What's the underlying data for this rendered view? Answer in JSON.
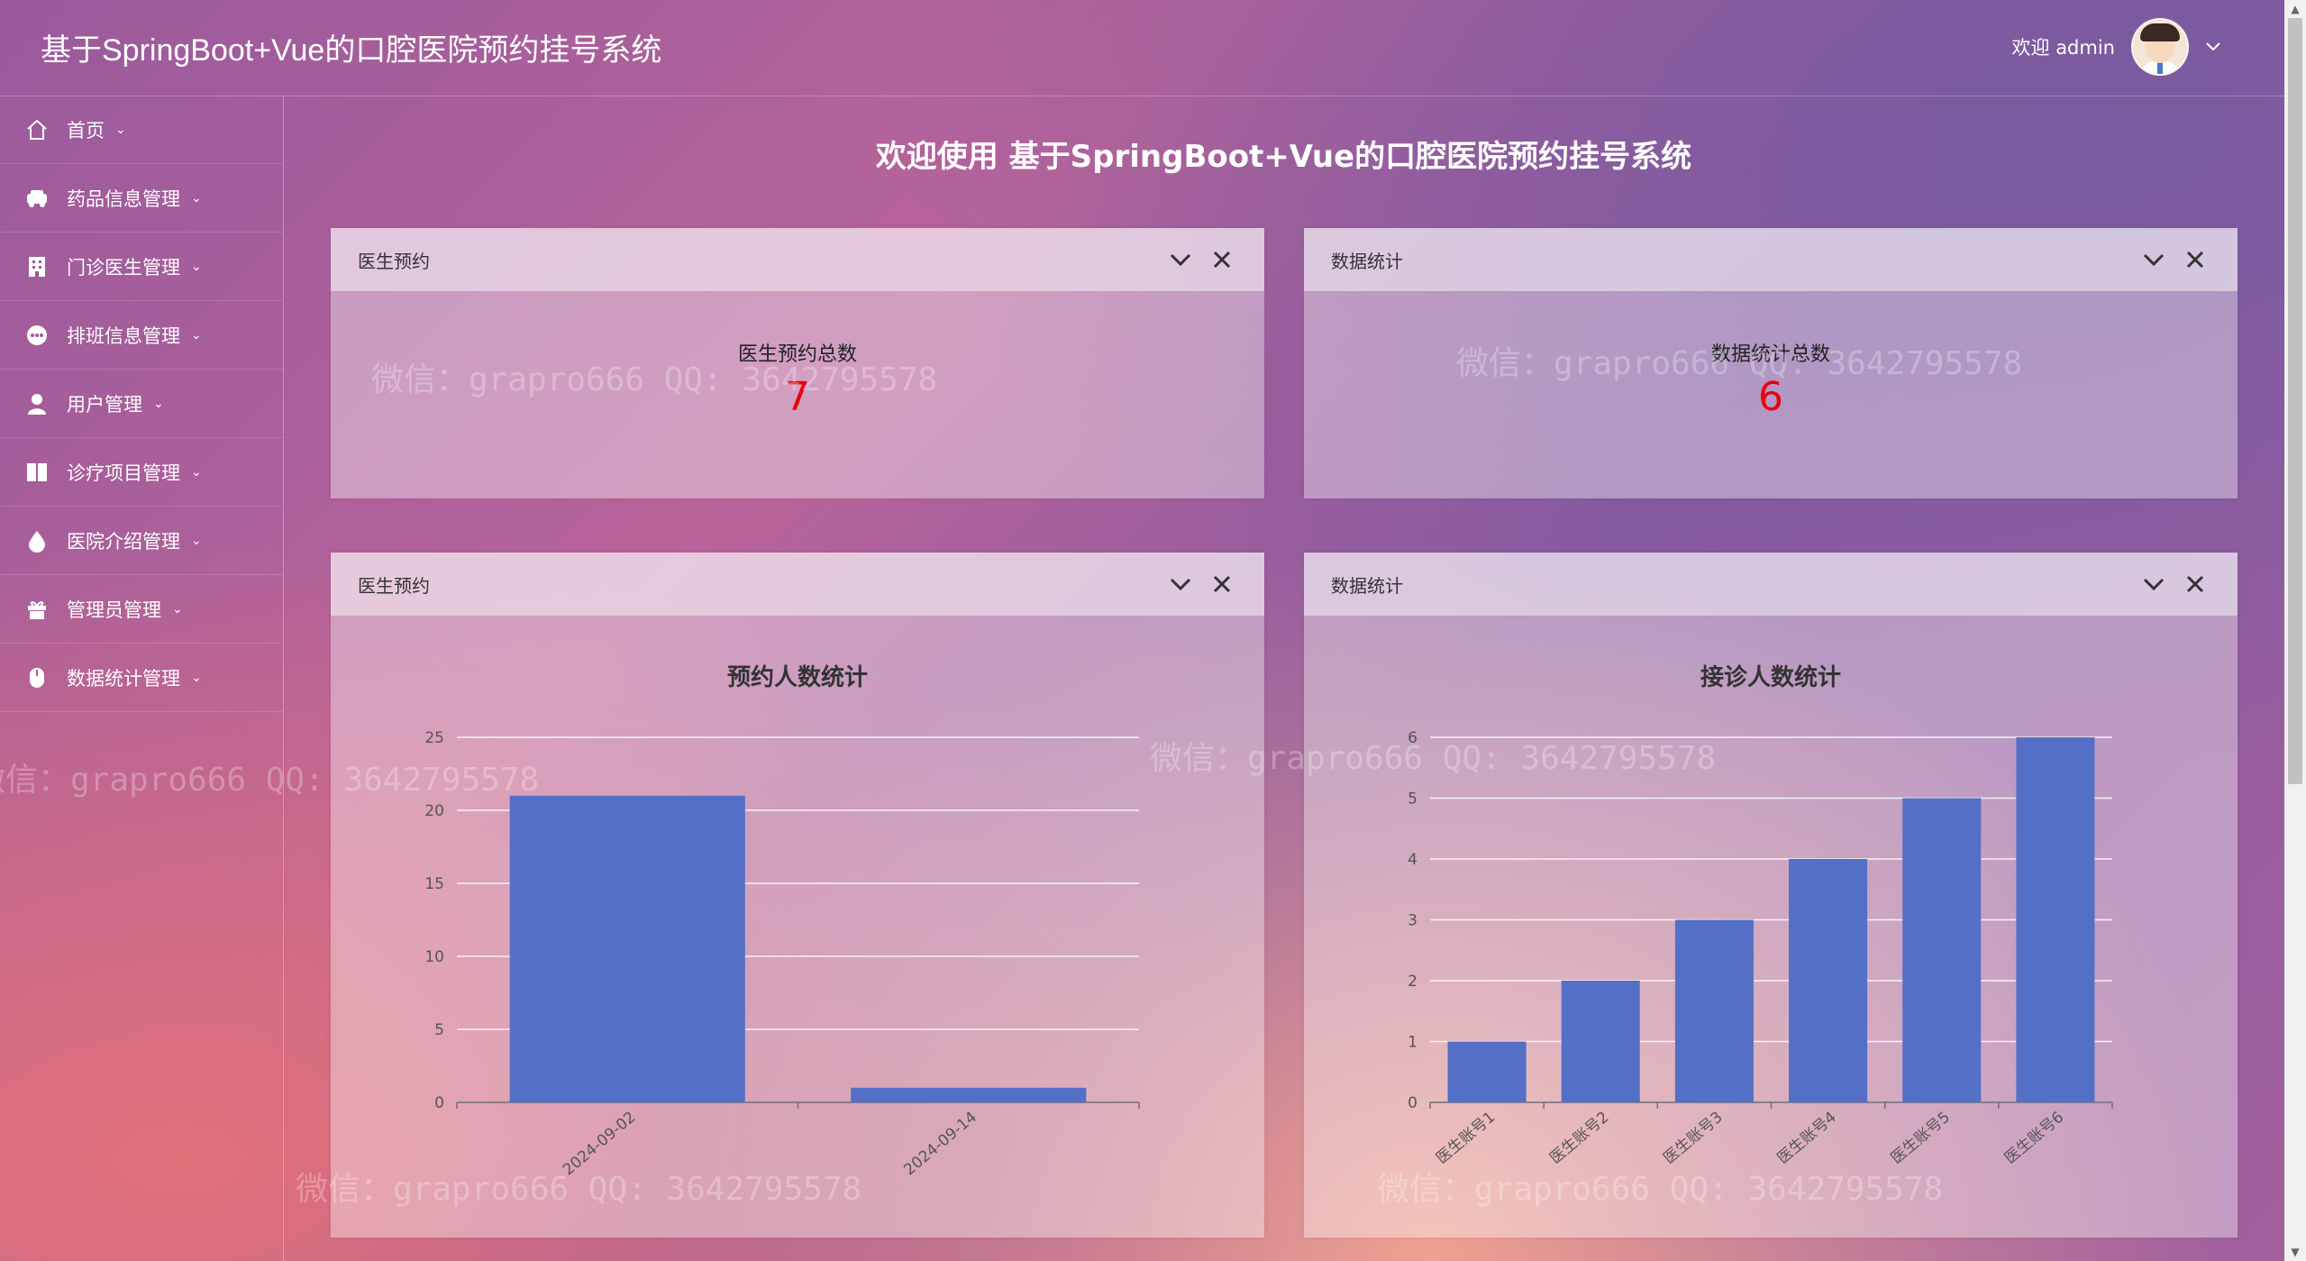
{
  "header": {
    "app_title": "基于SpringBoot+Vue的口腔医院预约挂号系统",
    "welcome": "欢迎 admin"
  },
  "sidebar": {
    "items": [
      {
        "label": "首页",
        "icon": "home-icon"
      },
      {
        "label": "药品信息管理",
        "icon": "car-icon"
      },
      {
        "label": "门诊医生管理",
        "icon": "building-icon"
      },
      {
        "label": "排班信息管理",
        "icon": "chat-dots-icon"
      },
      {
        "label": "用户管理",
        "icon": "user-icon"
      },
      {
        "label": "诊疗项目管理",
        "icon": "book-icon"
      },
      {
        "label": "医院介绍管理",
        "icon": "drop-icon"
      },
      {
        "label": "管理员管理",
        "icon": "gift-icon"
      },
      {
        "label": "数据统计管理",
        "icon": "mouse-icon"
      }
    ]
  },
  "main": {
    "welcome_title": "欢迎使用 基于SpringBoot+Vue的口腔医院预约挂号系统",
    "stat_panels": [
      {
        "header": "医生预约",
        "label": "医生预约总数",
        "value": "7"
      },
      {
        "header": "数据统计",
        "label": "数据统计总数",
        "value": "6"
      }
    ],
    "chart_panels": [
      {
        "header": "医生预约"
      },
      {
        "header": "数据统计"
      }
    ]
  },
  "watermark_text": "微信：grapro666 QQ: 3642795578",
  "colors": {
    "bar": "#5470c6",
    "stat_value": "#e8000b"
  },
  "chart_data": [
    {
      "type": "bar",
      "title": "预约人数统计",
      "categories": [
        "2024-09-02",
        "2024-09-14"
      ],
      "values": [
        21,
        1
      ],
      "ylim": [
        0,
        25
      ],
      "yticks": [
        0,
        5,
        10,
        15,
        20,
        25
      ],
      "grid": true
    },
    {
      "type": "bar",
      "title": "接诊人数统计",
      "categories": [
        "医生账号1",
        "医生账号2",
        "医生账号3",
        "医生账号4",
        "医生账号5",
        "医生账号6"
      ],
      "values": [
        1,
        2,
        3,
        4,
        5,
        6
      ],
      "ylim": [
        0,
        6
      ],
      "yticks": [
        0,
        1,
        2,
        3,
        4,
        5,
        6
      ],
      "grid": true
    }
  ]
}
